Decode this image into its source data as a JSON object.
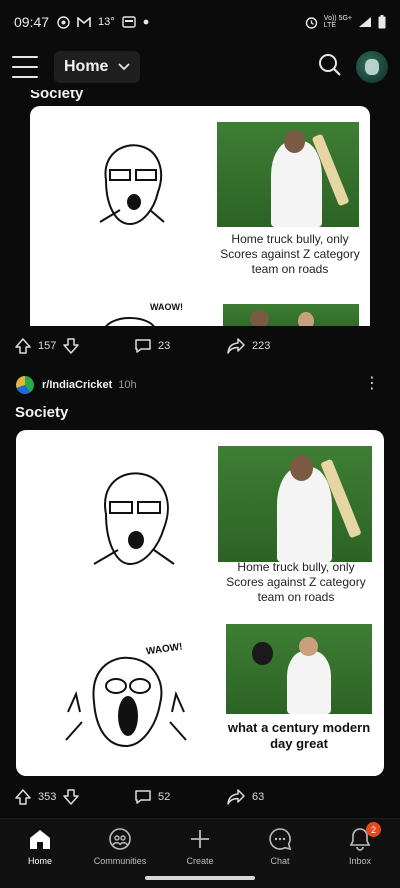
{
  "status_bar": {
    "time": "09:47",
    "temperature": "13°",
    "network_top": "Vo)) 5G+",
    "network_bottom": "LTE",
    "icons": [
      "target-icon",
      "gmail-icon",
      "tv-icon",
      "dot-icon",
      "alarm-icon",
      "signal-icon",
      "battery-icon"
    ]
  },
  "topbar": {
    "feed_label": "Home"
  },
  "posts": [
    {
      "title": "Society",
      "meme": {
        "caption_top": "Home truck bully, only Scores against Z category team on roads",
        "waow": "WAOW!"
      },
      "upvotes": "157",
      "comments": "23",
      "shares": "223"
    },
    {
      "subreddit": "r/IndiaCricket",
      "time": "10h",
      "title": "Society",
      "meme": {
        "caption_top": "Home truck bully, only Scores against Z category team on roads",
        "waow": "WAOW!",
        "caption_bottom": "what a century modern day great"
      },
      "upvotes": "353",
      "comments": "52",
      "shares": "63"
    }
  ],
  "bottom_nav": {
    "items": [
      {
        "label": "Home",
        "icon": "home-icon",
        "active": true
      },
      {
        "label": "Communities",
        "icon": "communities-icon"
      },
      {
        "label": "Create",
        "icon": "plus-icon"
      },
      {
        "label": "Chat",
        "icon": "chat-icon"
      },
      {
        "label": "Inbox",
        "icon": "bell-icon",
        "badge": "2"
      }
    ]
  },
  "colors": {
    "background": "#0b0b0b",
    "badge": "#e5471f",
    "nav_bar": "#111111"
  }
}
